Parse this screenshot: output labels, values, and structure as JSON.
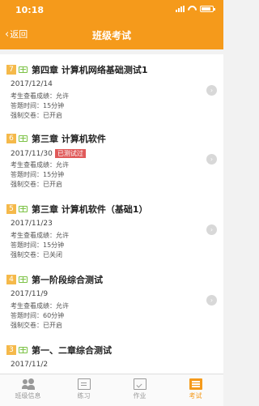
{
  "status_bar": {
    "time": "10:18"
  },
  "nav": {
    "back_label": "返回",
    "title": "班级考试"
  },
  "exams": [
    {
      "number": "7",
      "title": "第四章 计算机网络基础测试1",
      "date": "2017/12/14",
      "badge": "",
      "score_view": "考生查看成绩：允许",
      "duration": "答题时间：15分钟",
      "force_submit": "强制交卷：已开启"
    },
    {
      "number": "6",
      "title": "第三章 计算机软件",
      "date": "2017/11/30",
      "badge": "已测试过",
      "score_view": "考生查看成绩：允许",
      "duration": "答题时间：15分钟",
      "force_submit": "强制交卷：已开启"
    },
    {
      "number": "5",
      "title": "第三章 计算机软件（基础1）",
      "date": "2017/11/23",
      "badge": "",
      "score_view": "考生查看成绩：允许",
      "duration": "答题时间：15分钟",
      "force_submit": "强制交卷：已关闭"
    },
    {
      "number": "4",
      "title": "第一阶段综合测试",
      "date": "2017/11/9",
      "badge": "",
      "score_view": "考生查看成绩：允许",
      "duration": "答题时间：60分钟",
      "force_submit": "强制交卷：已开启"
    },
    {
      "number": "3",
      "title": "第一、二章综合测试",
      "date": "2017/11/2",
      "badge": "",
      "score_view": "",
      "duration": "",
      "force_submit": ""
    }
  ],
  "tabs": [
    {
      "label": "班级信息",
      "icon": "people-icon"
    },
    {
      "label": "练习",
      "icon": "document-icon"
    },
    {
      "label": "作业",
      "icon": "homework-icon"
    },
    {
      "label": "考试",
      "icon": "exam-icon"
    }
  ],
  "colors": {
    "accent": "#f59a1b",
    "badge": "#e05a5a",
    "number_tag": "#f5b94a",
    "book_icon": "#7cc245"
  }
}
